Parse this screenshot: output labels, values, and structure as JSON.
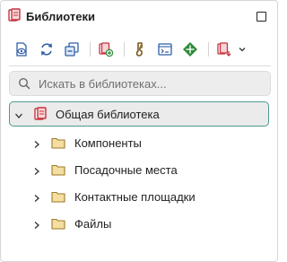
{
  "header": {
    "title": "Библиотеки"
  },
  "toolbar": {
    "buttons": [
      {
        "name": "view-library-icon"
      },
      {
        "name": "refresh-icon"
      },
      {
        "name": "collapse-all-icon"
      },
      {
        "name": "add-library-icon"
      },
      {
        "name": "tag-icon"
      },
      {
        "name": "properties-icon"
      },
      {
        "name": "move-icon"
      },
      {
        "name": "export-icon"
      }
    ]
  },
  "search": {
    "placeholder": "Искать в библиотеках..."
  },
  "tree": {
    "root": {
      "label": "Общая библиотека",
      "expanded": true
    },
    "children": [
      {
        "label": "Компоненты"
      },
      {
        "label": "Посадочные места"
      },
      {
        "label": "Контактные площадки"
      },
      {
        "label": "Файлы"
      }
    ]
  },
  "colors": {
    "accent_border": "#4f9a8e",
    "library_red": "#c8323c",
    "icon_blue": "#2f5fa8",
    "icon_green": "#2e8b3a",
    "icon_brown": "#7a5a1c",
    "folder_fill": "#f4dfa0",
    "folder_stroke": "#9b7a2a"
  }
}
